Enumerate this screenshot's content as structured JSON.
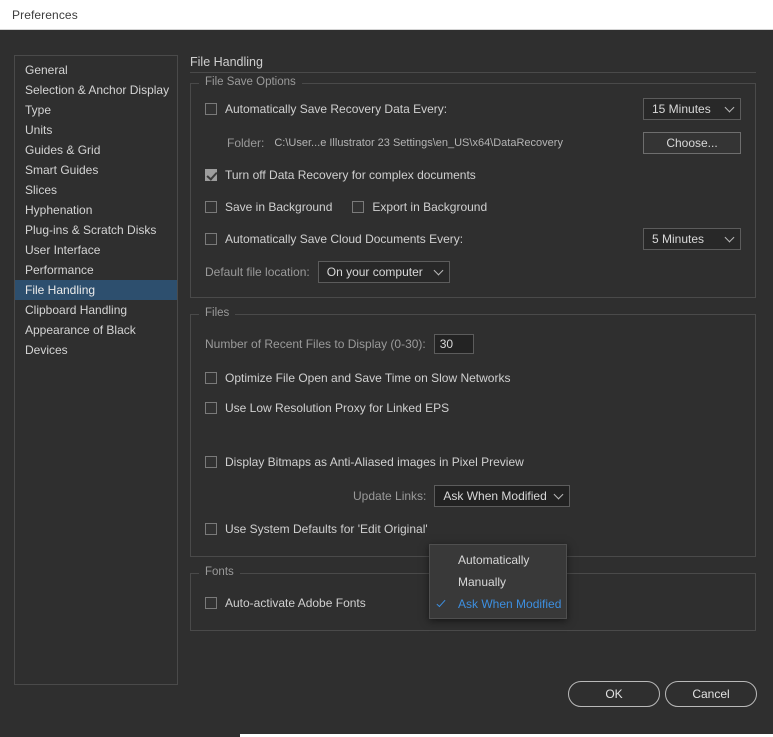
{
  "window": {
    "title": "Preferences"
  },
  "sidebar": {
    "items": [
      {
        "label": "General",
        "selected": false
      },
      {
        "label": "Selection & Anchor Display",
        "selected": false
      },
      {
        "label": "Type",
        "selected": false
      },
      {
        "label": "Units",
        "selected": false
      },
      {
        "label": "Guides & Grid",
        "selected": false
      },
      {
        "label": "Smart Guides",
        "selected": false
      },
      {
        "label": "Slices",
        "selected": false
      },
      {
        "label": "Hyphenation",
        "selected": false
      },
      {
        "label": "Plug-ins & Scratch Disks",
        "selected": false
      },
      {
        "label": "User Interface",
        "selected": false
      },
      {
        "label": "Performance",
        "selected": false
      },
      {
        "label": "File Handling",
        "selected": true
      },
      {
        "label": "Clipboard Handling",
        "selected": false
      },
      {
        "label": "Appearance of Black",
        "selected": false
      },
      {
        "label": "Devices",
        "selected": false
      }
    ]
  },
  "panel": {
    "title": "File Handling",
    "file_save_options": {
      "legend": "File Save Options",
      "auto_save_recovery_label": "Automatically Save Recovery Data Every:",
      "auto_save_recovery_checked": false,
      "recovery_interval_value": "15 Minutes",
      "folder_label": "Folder:",
      "folder_path": "C:\\User...e Illustrator 23 Settings\\en_US\\x64\\DataRecovery",
      "choose_button": "Choose...",
      "turn_off_recovery_label": "Turn off Data Recovery for complex documents",
      "turn_off_recovery_checked": true,
      "save_in_background_label": "Save in Background",
      "save_in_background_checked": false,
      "export_in_background_label": "Export in Background",
      "export_in_background_checked": false,
      "auto_save_cloud_label": "Automatically Save Cloud Documents Every:",
      "auto_save_cloud_checked": false,
      "cloud_interval_value": "5 Minutes",
      "default_file_location_label": "Default file location:",
      "default_file_location_value": "On your computer"
    },
    "files": {
      "legend": "Files",
      "recent_files_label": "Number of Recent Files to Display (0-30):",
      "recent_files_value": "30",
      "optimize_slow_networks_label": "Optimize File Open and Save Time on Slow Networks",
      "optimize_slow_networks_checked": false,
      "low_res_proxy_label": "Use Low Resolution Proxy for Linked EPS",
      "low_res_proxy_checked": false,
      "display_bitmaps_label": "Display Bitmaps as Anti-Aliased images in Pixel Preview",
      "display_bitmaps_checked": false,
      "update_links_label": "Update Links:",
      "update_links_value": "Ask When Modified",
      "system_defaults_label": "Use System Defaults for 'Edit Original'",
      "system_defaults_checked": false
    },
    "fonts": {
      "legend": "Fonts",
      "auto_activate_label": "Auto-activate Adobe Fonts",
      "auto_activate_checked": false
    }
  },
  "update_links_menu": {
    "open": true,
    "options": [
      {
        "label": "Automatically",
        "selected": false
      },
      {
        "label": "Manually",
        "selected": false
      },
      {
        "label": "Ask When Modified",
        "selected": true
      }
    ]
  },
  "footer": {
    "ok_label": "OK",
    "cancel_label": "Cancel"
  },
  "colors": {
    "dialog_bg": "#2f2f2f",
    "titlebar_bg": "#ffffff",
    "selection_blue": "#2d4f6e",
    "accent_blue": "#3d8fe0",
    "border": "#4a4a4a",
    "text": "#d0d0d0",
    "text_dim": "#9a9a9a"
  }
}
